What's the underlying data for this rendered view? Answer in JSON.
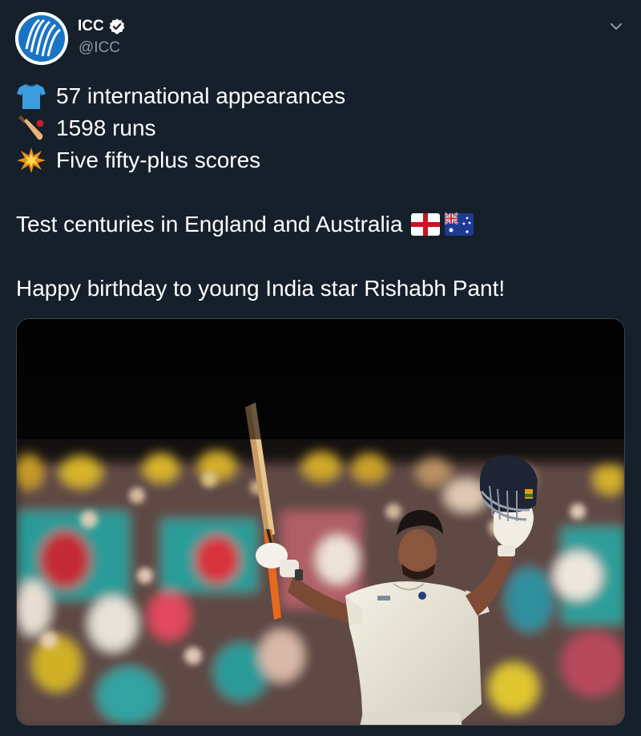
{
  "header": {
    "display_name": "ICC",
    "handle": "@ICC",
    "verified_icon": "verified-badge-icon",
    "avatar_icon": "icc-logo-avatar",
    "menu_icon": "chevron-down-icon"
  },
  "tweet": {
    "lines": [
      {
        "icon": "shirt-icon",
        "text": "57 international appearances"
      },
      {
        "icon": "cricket-bat-icon",
        "text": "1598 runs"
      },
      {
        "icon": "collision-icon",
        "text": "Five fifty-plus scores"
      }
    ],
    "centuries_text": "Test centuries in England and Australia",
    "flags": [
      "england-flag-icon",
      "australia-flag-icon"
    ],
    "birthday_text": "Happy birthday to young India star Rishabh Pant!"
  },
  "media": {
    "type": "photo",
    "subject": "player-celebrating-photo"
  },
  "colors": {
    "background": "#15202b",
    "text_primary": "#ffffff",
    "text_secondary": "#8899a6",
    "verified": "#ffffff",
    "border": "#38444d"
  }
}
